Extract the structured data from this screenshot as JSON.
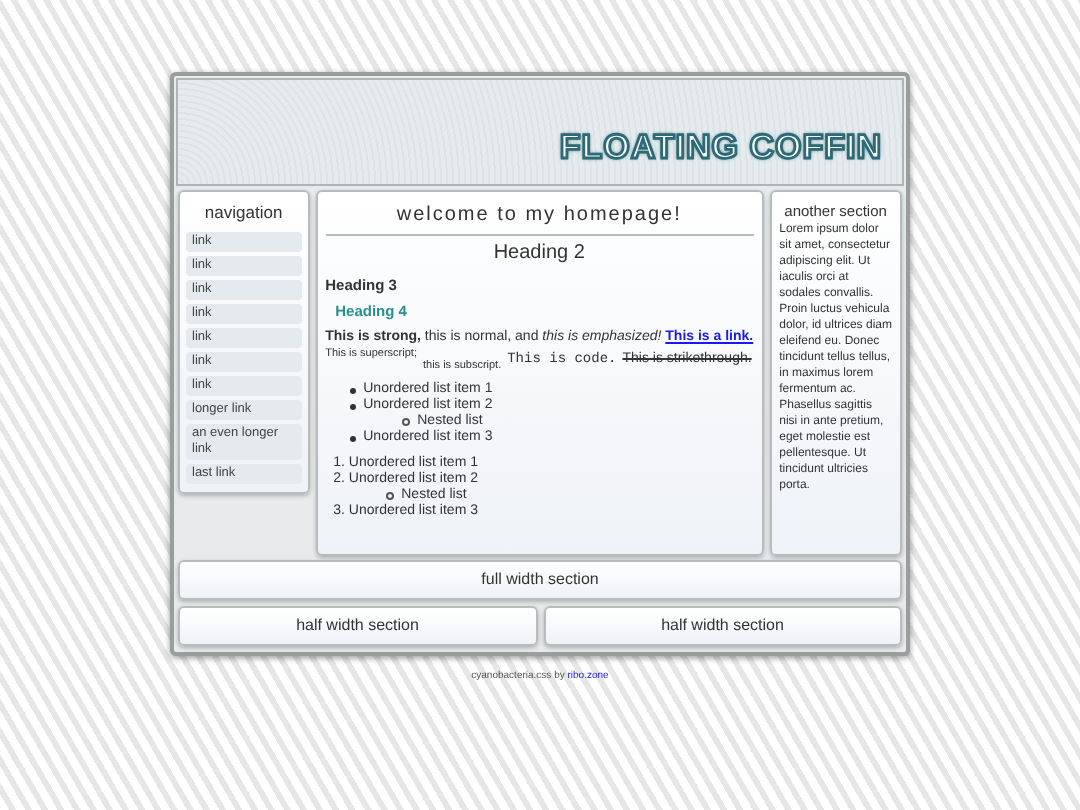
{
  "header": {
    "title": "FLOATING COFFIN"
  },
  "navigation": {
    "title": "navigation",
    "items": [
      {
        "label": "link"
      },
      {
        "label": "link"
      },
      {
        "label": "link"
      },
      {
        "label": "link"
      },
      {
        "label": "link"
      },
      {
        "label": "link"
      },
      {
        "label": "link"
      },
      {
        "label": "longer link"
      },
      {
        "label": "an even longer link"
      },
      {
        "label": "last link"
      }
    ]
  },
  "main": {
    "title": "welcome to my homepage!",
    "heading2": "Heading 2",
    "heading3": "Heading 3",
    "heading4": "Heading 4",
    "paragraph": {
      "text": "**This is strong,** this is normal, and *this is emphasized!*",
      "link": "This is a link."
    },
    "inline_samples": [
      {
        "kind": "superscript",
        "text": "This is superscript;"
      },
      {
        "kind": "subscript",
        "text": "this is subscript."
      },
      {
        "kind": "code",
        "text": "This is code."
      },
      {
        "kind": "strikethrough",
        "text": "This is strikethrough."
      }
    ],
    "unordered_list": [
      {
        "text": "Unordered list item 1"
      },
      {
        "text": "Unordered list item 2",
        "children": [
          {
            "text": "Nested list"
          }
        ]
      },
      {
        "text": "Unordered list item 3"
      }
    ],
    "ordered_list": [
      {
        "number": "1.",
        "text": "Unordered list item 1"
      },
      {
        "number": "2.",
        "text": "Unordered list item 2",
        "children": [
          {
            "text": "Nested list"
          }
        ]
      },
      {
        "number": "3.",
        "text": "Unordered list item 3"
      }
    ]
  },
  "sidebar": {
    "title": "another section",
    "text": "Lorem ipsum dolor sit amet, consectetur adipiscing elit. Ut iaculis orci at sodales convallis. Proin luctus vehicula dolor, id ultrices diam eleifend eu. Donec tincidunt tellus tellus, in maximus lorem fermentum ac. Phasellus sagittis nisi in ante pretium, eget molestie est pellentesque. Ut tincidunt ultricies porta."
  },
  "sections": [
    {
      "label": "full width section"
    },
    {
      "label": "half width section"
    },
    {
      "label": "half width section"
    }
  ],
  "footer": {
    "text": "cyanobacteria.css by",
    "link": "ribo.zone"
  }
}
